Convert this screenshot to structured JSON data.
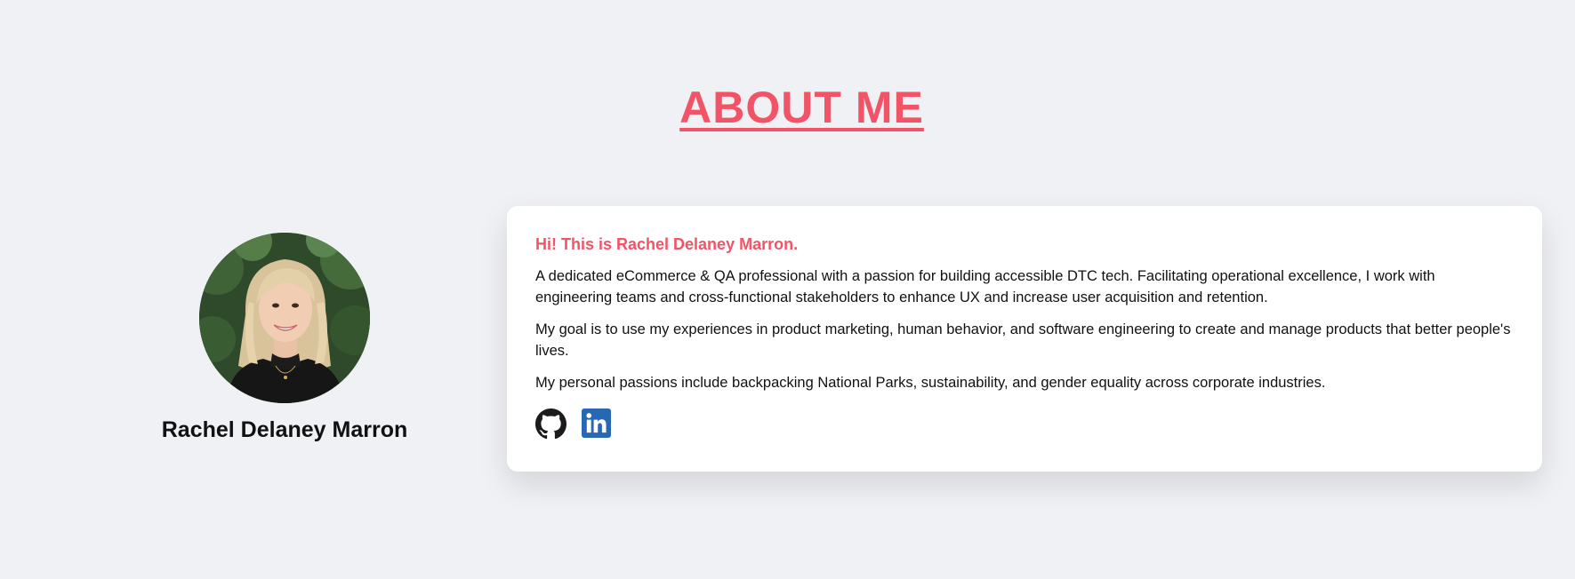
{
  "section": {
    "title": "ABOUT ME"
  },
  "profile": {
    "name": "Rachel Delaney Marron",
    "avatar_icon": "profile-photo"
  },
  "card": {
    "greeting": "Hi! This is Rachel Delaney Marron.",
    "paragraphs": [
      "A dedicated eCommerce & QA professional with a passion for building accessible DTC tech. Facilitating operational excellence, I work with engineering teams and cross-functional stakeholders to enhance UX and increase user acquisition and retention.",
      "My goal is to use my experiences in product marketing, human behavior, and software engineering to create and manage products that better people's lives.",
      "My personal passions include backpacking National Parks, sustainability, and gender equality across corporate industries."
    ],
    "socials": [
      {
        "icon": "github-icon"
      },
      {
        "icon": "linkedin-icon"
      }
    ]
  },
  "colors": {
    "accent": "#f25467",
    "background": "#f0f1f5",
    "card": "#ffffff",
    "linkedin": "#2867b2"
  }
}
